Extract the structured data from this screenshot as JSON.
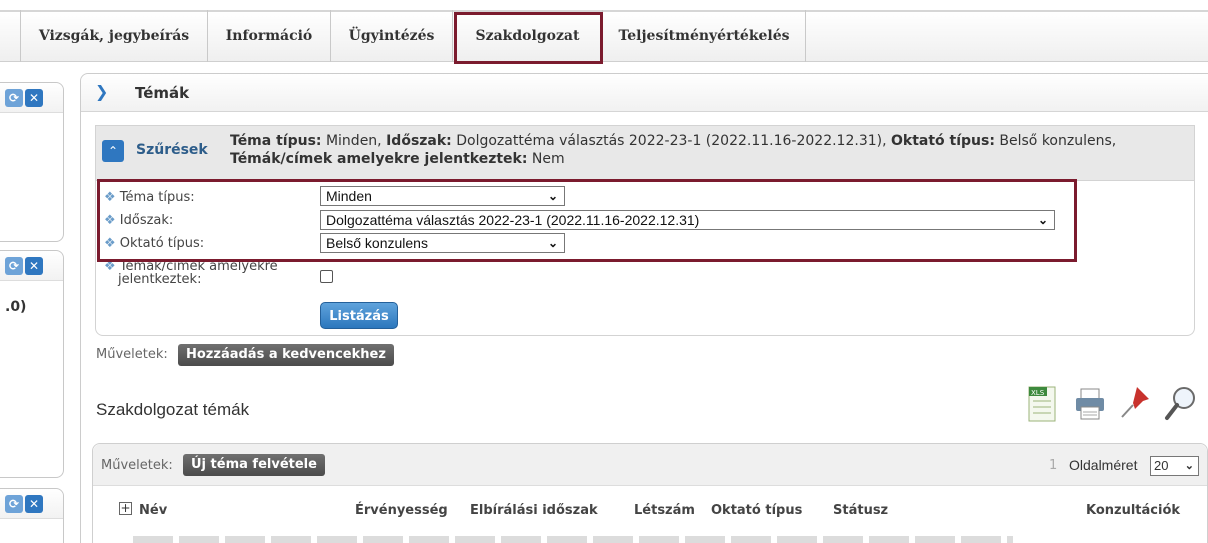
{
  "nav": {
    "tabs": [
      {
        "label": "Vizsgák, jegybeírás"
      },
      {
        "label": "Információ"
      },
      {
        "label": "Ügyintézés"
      },
      {
        "label": "Szakdolgozat"
      },
      {
        "label": "Teljesítményértékelés"
      }
    ],
    "active_tab": "Szakdolgozat"
  },
  "left_panels": {
    "count_fragment": ".0)"
  },
  "main": {
    "title": "Témák",
    "filter": {
      "header": "Szűrések",
      "summary": {
        "k1": "Téma típus:",
        "v1": " Minden, ",
        "k2": "Időszak:",
        "v2": " Dolgozattéma választás 2022-23-1 (2022.11.16-2022.12.31), ",
        "k3": "Oktató típus:",
        "v3": " Belső konzulens,",
        "k4": "Témák/címek amelyekre jelentkeztek:",
        "v4": " Nem"
      },
      "fields": {
        "topic_type_label": "Téma típus:",
        "topic_type_value": "Minden",
        "period_label": "Időszak:",
        "period_value": "Dolgozattéma választás 2022-23-1 (2022.11.16-2022.12.31)",
        "teacher_type_label": "Oktató típus:",
        "teacher_type_value": "Belső konzulens",
        "applied_label_1": "Témák/címek amelyekre",
        "applied_label_2": "jelentkeztek:"
      },
      "list_button": "Listázás"
    },
    "operations_label": "Műveletek:",
    "add_favorite_button": "Hozzáadás a kedvencekhez",
    "section_title": "Szakdolgozat témák",
    "grid": {
      "operations_label": "Műveletek:",
      "new_topic_button": "Új téma felvétele",
      "page_number": "1",
      "page_size_label": "Oldalméret",
      "page_size_value": "20",
      "columns": [
        "Név",
        "Érvényesség",
        "Elbírálási időszak",
        "Létszám",
        "Oktató típus",
        "Státusz",
        "Konzultációk"
      ]
    },
    "toolbar_icons": [
      "excel-export-icon",
      "print-icon",
      "pin-icon",
      "search-icon"
    ]
  },
  "colors": {
    "accent_blue": "#2f77c0",
    "highlight_red": "#7b1b2e"
  }
}
